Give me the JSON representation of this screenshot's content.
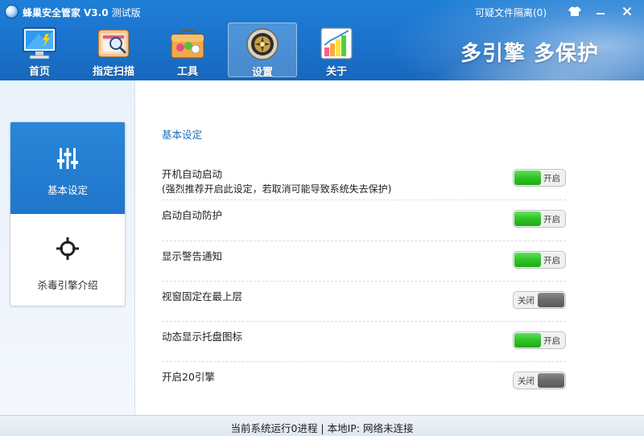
{
  "window": {
    "app_name": "蜂巢安全管家",
    "version": "V3.0",
    "edition": "测试版",
    "quarantine_link": "可疑文件隔离(0)",
    "slogan": "多引擎 多保护"
  },
  "nav": {
    "items": [
      {
        "label": "首页",
        "icon": "monitor-icon"
      },
      {
        "label": "指定扫描",
        "icon": "folder-scan-icon"
      },
      {
        "label": "工具",
        "icon": "toolbox-icon"
      },
      {
        "label": "设置",
        "icon": "settings-gear-icon",
        "active": true
      },
      {
        "label": "关于",
        "icon": "chart-icon"
      }
    ]
  },
  "sidebar": {
    "items": [
      {
        "label": "基本设定",
        "icon": "sliders-icon",
        "active": true
      },
      {
        "label": "杀毒引擎介绍",
        "icon": "crosshair-icon"
      }
    ]
  },
  "settings": {
    "section_title": "基本设定",
    "rows": [
      {
        "label": "开机自动启动",
        "note": "(强烈推荐开启此设定，若取消可能导致系统失去保护)",
        "state": "开启",
        "on": true
      },
      {
        "label": "启动自动防护",
        "state": "开启",
        "on": true
      },
      {
        "label": "显示警告通知",
        "state": "开启",
        "on": true
      },
      {
        "label": "视窗固定在最上层",
        "state": "关闭",
        "on": false
      },
      {
        "label": "动态显示托盘图标",
        "state": "开启",
        "on": true
      },
      {
        "label": "开启20引擎",
        "state": "关闭",
        "on": false
      }
    ]
  },
  "status": {
    "text": "当前系统运行0进程 | 本地IP: 网络未连接"
  },
  "colors": {
    "header_blue": "#1f7fd6",
    "sidebar_active": "#2a86d8",
    "toggle_on": "#2fc425",
    "toggle_off": "#6a6a6a",
    "section_title": "#1f6fb8"
  }
}
